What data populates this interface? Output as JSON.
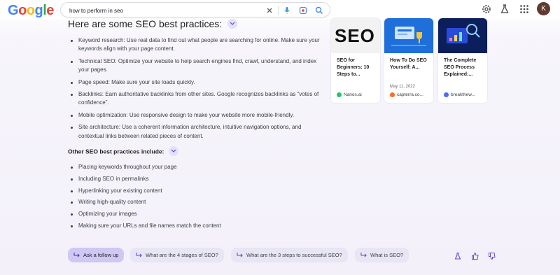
{
  "header": {
    "logo": [
      "G",
      "o",
      "o",
      "g",
      "l",
      "e"
    ],
    "search_value": "how to perform in seo",
    "avatar_letter": "K"
  },
  "main": {
    "heading": "Here are some SEO best practices:",
    "best_practices": [
      "Keyword research: Use real data to find out what people are searching for online. Make sure your keywords align with your page content.",
      "Technical SEO: Optimize your website to help search engines find, crawl, understand, and index your pages.",
      "Page speed: Make sure your site loads quickly.",
      "Backlinks: Earn authoritative backlinks from other sites. Google recognizes backlinks as “votes of confidence”.",
      "Mobile optimization: Use responsive design to make your website more mobile-friendly.",
      "Site architecture: Use a coherent information architecture, intuitive navigation options, and contextual links between related pieces of content."
    ],
    "other_heading": "Other SEO best practices include:",
    "other_practices": [
      "Placing keywords throughout your page",
      "Including SEO in permalinks",
      "Hyperlinking your existing content",
      "Writing high-quality content",
      "Optimizing your images",
      "Making sure your URLs and file names match the content"
    ]
  },
  "cards": [
    {
      "title": "SEO for Beginners: 10 Steps to...",
      "date": "",
      "source": "Nanos.ai",
      "img_text": "SEO",
      "fav_color": "#2fbf71"
    },
    {
      "title": "How To Do SEO Yourself: A...",
      "date": "May 11, 2022",
      "source": "capterra.co...",
      "img_text": "",
      "fav_color": "#ff6b2c"
    },
    {
      "title": "The Complete SEO Process Explained:...",
      "date": "",
      "source": "breakthew...",
      "img_text": "",
      "fav_color": "#4a6cf7"
    }
  ],
  "followups": {
    "ask": "Ask a follow up",
    "q1": "What are the 4 stages of SEO?",
    "q2": "What are the 3 steps to successful SEO?",
    "q3": "What is SEO?"
  },
  "colors": {
    "accent": "#cfc8f5",
    "chip": "#e8e5f4",
    "icon": "#5a4fcf"
  }
}
